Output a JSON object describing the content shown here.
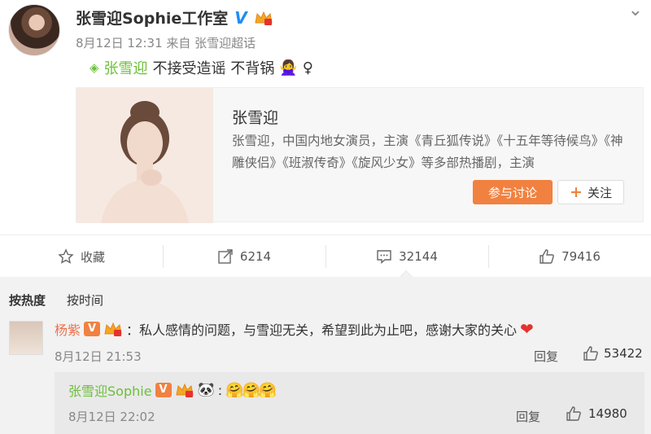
{
  "post": {
    "author": "张雪迎Sophie工作室",
    "verified_mark": "V",
    "meta": "8月12日 12:31 来自 张雪迎超话",
    "topic_link": "张雪迎",
    "text": " 不接受造谣 不背锅",
    "emoji": "🙅‍♀️",
    "gender_symbol": "♀",
    "close_icon": "⌄"
  },
  "card": {
    "title": "张雪迎",
    "description": "张雪迎，中国内地女演员，主演《青丘狐传说》《十五年等待候鸟》《神雕侠侣》《班淑传奇》《旋风少女》等多部热播剧，主演",
    "discuss_label": "参与讨论",
    "follow_label": "关注",
    "follow_plus": "+"
  },
  "actions": {
    "favorite_label": "收藏",
    "repost_count": "6214",
    "comment_count": "32144",
    "like_count": "79416"
  },
  "comments": {
    "tab_hot": "按热度",
    "tab_time": "按时间",
    "items": [
      {
        "name": "杨紫",
        "vip": "V",
        "text": "：私人感情的问题，与雪迎无关，希望到此为止吧，感谢大家的关心",
        "heart": "❤",
        "time": "8月12日 21:53",
        "reply_label": "回复",
        "likes": "53422",
        "sub": {
          "name": "张雪迎Sophie",
          "vip": "V",
          "panda": "🐼",
          "text": ":",
          "hugs": "🤗🤗🤗",
          "time": "8月12日 22:02",
          "reply_label": "回复",
          "likes": "14980"
        }
      }
    ]
  },
  "colors": {
    "accent_orange": "#f18140",
    "topic_green": "#6cbf3a",
    "name_orange": "#eb7350",
    "verified_blue": "#1e8ef3"
  }
}
